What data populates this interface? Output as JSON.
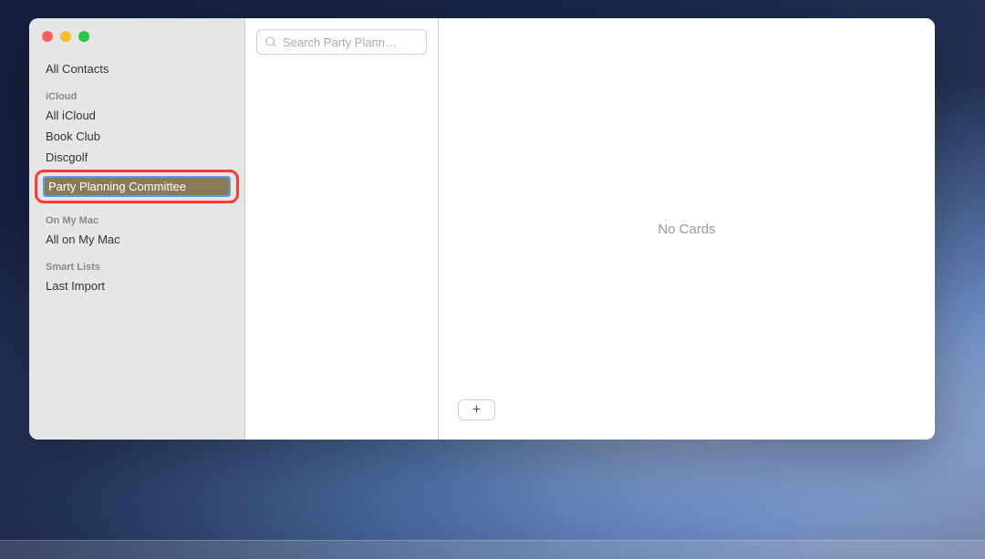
{
  "sidebar": {
    "all_contacts": "All Contacts",
    "sections": {
      "icloud": {
        "header": "iCloud",
        "items": [
          "All iCloud",
          "Book Club",
          "Discgolf"
        ]
      },
      "on_my_mac": {
        "header": "On My Mac",
        "items": [
          "All on My Mac"
        ]
      },
      "smart_lists": {
        "header": "Smart Lists",
        "items": [
          "Last Import"
        ]
      }
    },
    "editing_group": "Party Planning Committee"
  },
  "search": {
    "placeholder": "Search Party Plann…"
  },
  "main": {
    "empty_message": "No Cards"
  },
  "add_button": {
    "glyph": "+"
  }
}
